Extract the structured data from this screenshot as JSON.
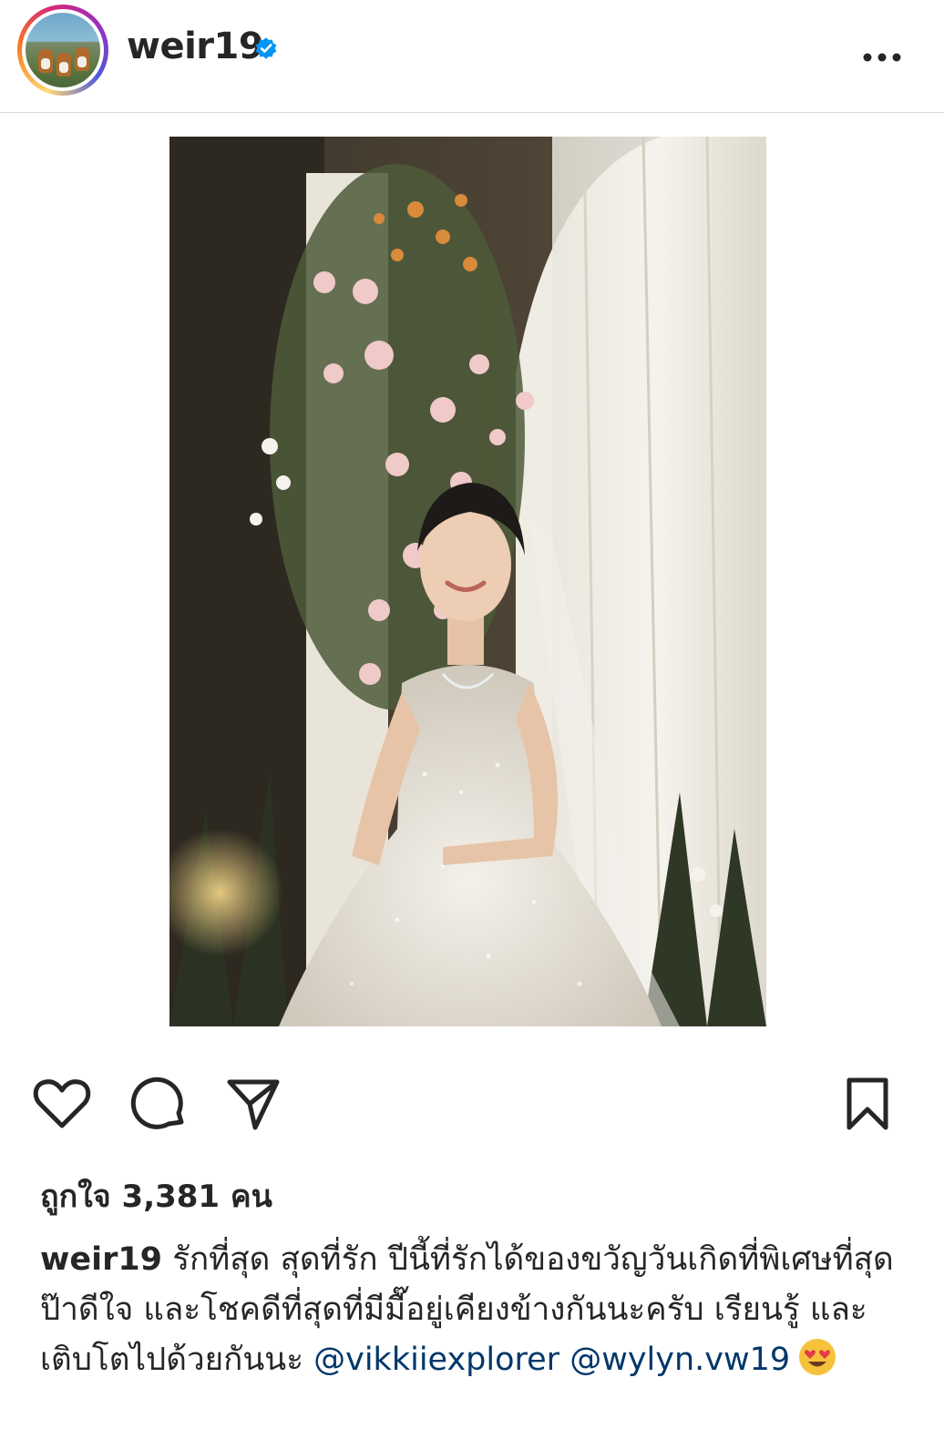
{
  "header": {
    "username": "weir19",
    "verified": true,
    "more_icon": "more-horizontal-icon"
  },
  "post": {
    "image_icon": "photo",
    "accent_color": "#0095f6"
  },
  "actions": {
    "like_icon": "heart-icon",
    "comment_icon": "comment-icon",
    "share_icon": "send-icon",
    "save_icon": "bookmark-icon"
  },
  "likes": {
    "text": "ถูกใจ 3,381 คน"
  },
  "caption": {
    "username": "weir19",
    "text": "รักที่สุด สุดที่รัก ปีนี้ที่รักได้ของขวัญวันเกิดที่พิเศษที่สุด ป๊าดีใจ และโชคดีที่สุดที่มีมื๊อยู่เคียงข้างกันนะครับ เรียนรู้ และเติบโตไปด้วยกันนะ ",
    "mention_1": "@vikkiiexplorer",
    "mention_2": "@wylyn.vw19",
    "emoji": "heart-eyes-emoji"
  }
}
